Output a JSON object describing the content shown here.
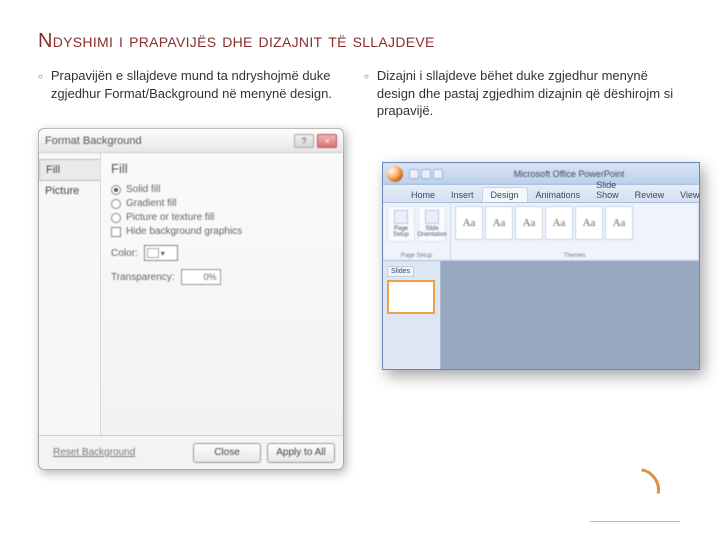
{
  "slide": {
    "title": "Ndyshimi i prapavijës dhe dizajnit të sllajdeve",
    "left_bullet": "Prapavijën e sllajdeve mund ta ndryshojmë duke zgjedhur Format/Background në menynë design.",
    "right_bullet": "Dizajni i sllajdeve bëhet duke zgjedhur menynë design dhe pastaj zgjedhim dizajnin që dëshirojm si prapavijë."
  },
  "dialog": {
    "title": "Format Background",
    "side": {
      "fill": "Fill",
      "picture": "Picture"
    },
    "heading": "Fill",
    "options": {
      "solid": "Solid fill",
      "gradient": "Gradient fill",
      "picture": "Picture or texture fill",
      "hide": "Hide background graphics"
    },
    "color_label": "Color:",
    "transparency_label": "Transparency:",
    "transparency_value": "0%",
    "reset": "Reset Background",
    "close": "Close",
    "apply": "Apply to All"
  },
  "pp": {
    "window_title": "Microsoft Office PowerPoint",
    "tabs": {
      "home": "Home",
      "insert": "Insert",
      "design": "Design",
      "animations": "Animations",
      "slideshow": "Slide Show",
      "review": "Review",
      "view": "View"
    },
    "groups": {
      "page_setup": "Page Setup",
      "slide_orientation": "Slide Orientation",
      "themes": "Themes"
    },
    "theme_glyph": "Aa",
    "slides_tab": "Slides"
  }
}
